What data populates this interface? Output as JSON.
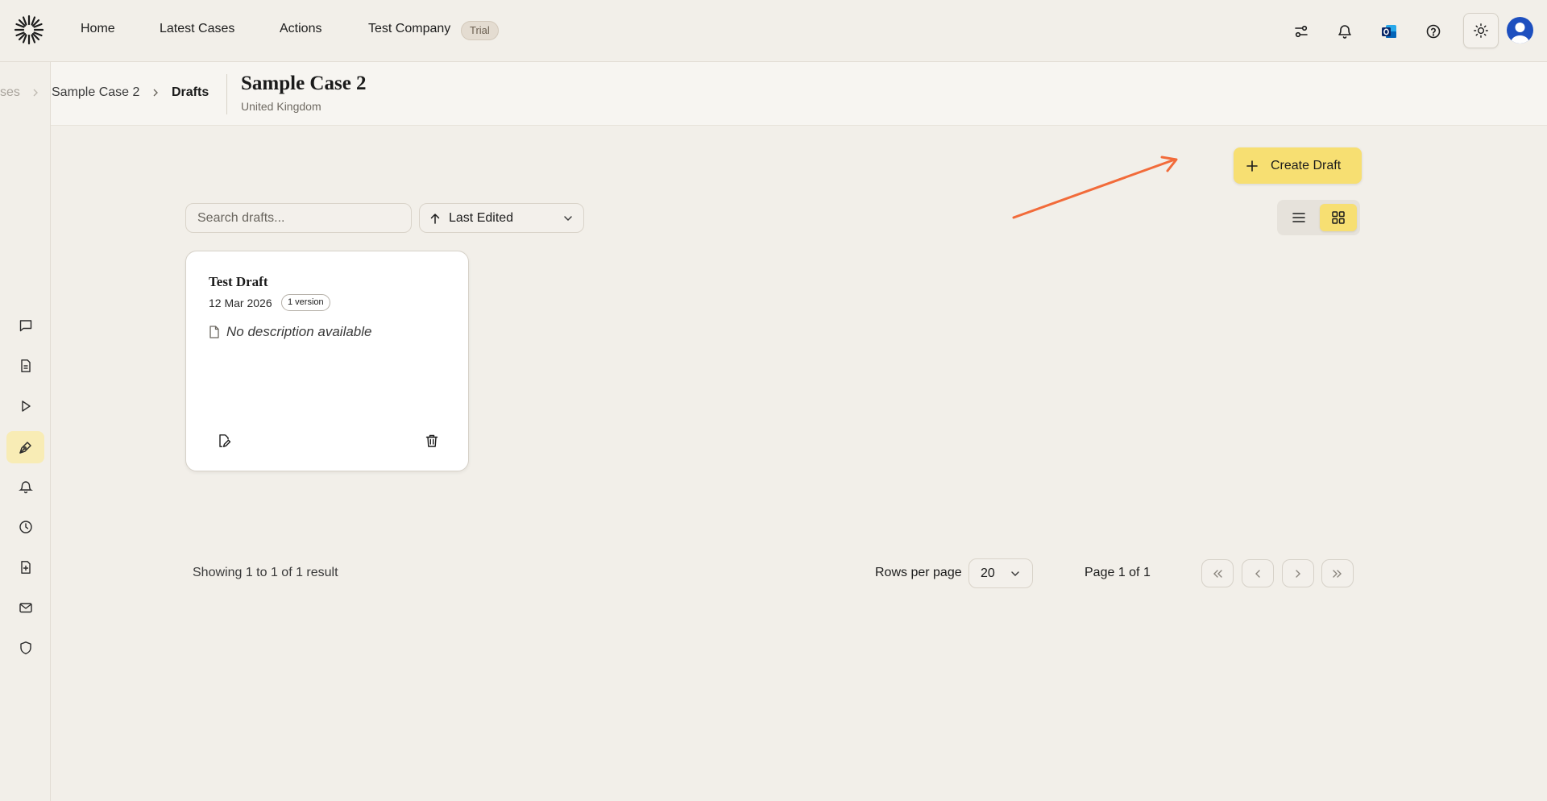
{
  "nav": {
    "home": "Home",
    "latest_cases": "Latest Cases",
    "actions": "Actions",
    "company": "Test Company",
    "trial_badge": "Trial"
  },
  "top_icons": [
    "sliders-icon",
    "bell-icon",
    "outlook-icon",
    "help-icon",
    "sun-icon",
    "avatar"
  ],
  "breadcrumb": {
    "faded": "ses",
    "case": "Sample Case 2",
    "current": "Drafts"
  },
  "case_header": {
    "title": "Sample Case 2",
    "subtitle": "United Kingdom"
  },
  "toolbar": {
    "create_label": "Create Draft",
    "search_placeholder": "Search drafts...",
    "sort_label": "Last Edited",
    "active_view": "grid"
  },
  "drafts": [
    {
      "title": "Test Draft",
      "date": "12 Mar 2026",
      "version_badge": "1 version",
      "description": "No description available"
    }
  ],
  "pagination": {
    "showing": "Showing 1 to 1 of 1 result",
    "rows_label": "Rows per page",
    "rows_value": "20",
    "page_label": "Page 1 of 1"
  },
  "sidebar_icons": [
    "chat-icon",
    "document-icon",
    "play-icon",
    "pen-icon",
    "bell-icon",
    "clock-icon",
    "file-plus-icon",
    "mail-icon",
    "shield-icon"
  ],
  "colors": {
    "background": "#f2efe9",
    "accent_yellow": "#f7df72",
    "annotation_arrow": "#f26b3a",
    "avatar_blue": "#1d4fbf"
  }
}
